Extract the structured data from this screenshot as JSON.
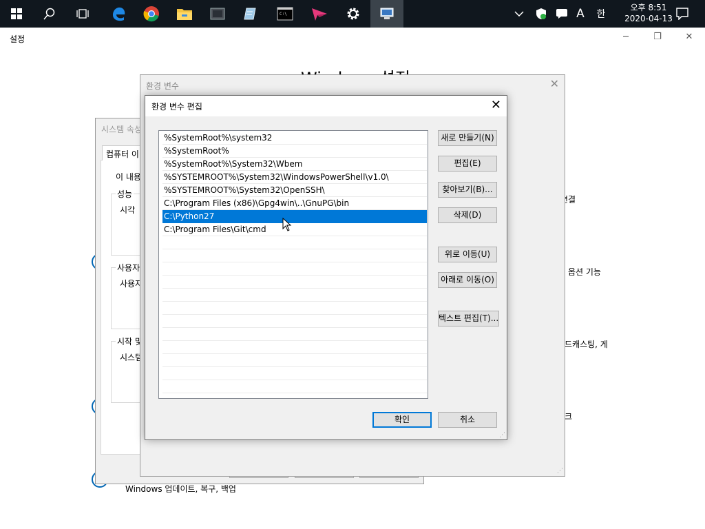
{
  "taskbar": {
    "clock_time": "오후 8:51",
    "clock_date": "2020-04-13",
    "ime_mode": "A",
    "ime_lang": "한"
  },
  "settings": {
    "window_title": "설정",
    "heading": "Windows 설정",
    "right_texts": [
      "연결",
      "옵션 기능",
      "드캐스팅, 게",
      "크"
    ],
    "bottom_text": "Windows 업데이트, 복구, 백업"
  },
  "system_properties": {
    "title": "시스템 속성",
    "tab_label": "컴퓨터 이",
    "intro": "이 내용",
    "group_performance": "성능",
    "performance_text": "시각",
    "group_user": "사용자",
    "user_text": "사용자",
    "group_startup": "시작 및",
    "startup_text": "시스템"
  },
  "env_vars": {
    "title": "환경 변수"
  },
  "edit_dialog": {
    "title": "환경 변수 편집",
    "paths": [
      "%SystemRoot%\\system32",
      "%SystemRoot%",
      "%SystemRoot%\\System32\\Wbem",
      "%SYSTEMROOT%\\System32\\WindowsPowerShell\\v1.0\\",
      "%SYSTEMROOT%\\System32\\OpenSSH\\",
      "C:\\Program Files (x86)\\Gpg4win\\..\\GnuPG\\bin",
      "C:\\Python27",
      "C:\\Program Files\\Git\\cmd"
    ],
    "selected_index": 6,
    "buttons": {
      "new": "새로 만들기(N)",
      "edit": "편집(E)",
      "browse": "찾아보기(B)...",
      "delete": "삭제(D)",
      "move_up": "위로 이동(U)",
      "move_down": "아래로 이동(O)",
      "edit_text": "텍스트 편집(T)...",
      "ok": "확인",
      "cancel": "취소"
    }
  },
  "colors": {
    "taskbar_bg": "#10171e",
    "selection": "#0078d7",
    "accent_icon": "#0066b4"
  }
}
